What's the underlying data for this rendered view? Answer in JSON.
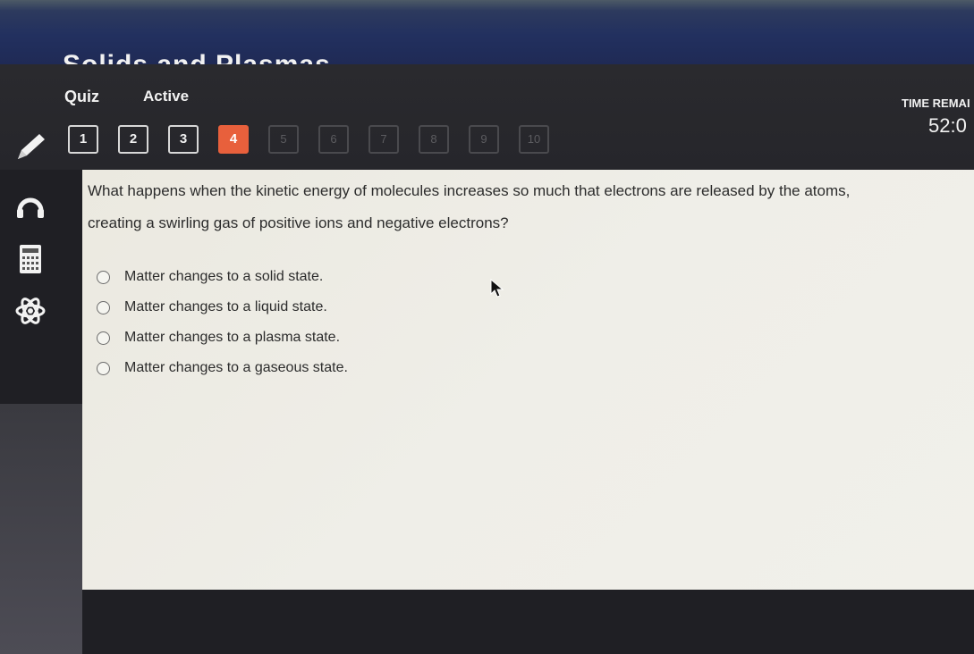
{
  "header": {
    "course_title": "Solids and Plasmas",
    "quiz_label": "Quiz",
    "status": "Active",
    "time_label": "TIME REMAI",
    "time_value": "52:0"
  },
  "question_nav": [
    {
      "label": "1",
      "state": "answered"
    },
    {
      "label": "2",
      "state": "answered"
    },
    {
      "label": "3",
      "state": "answered"
    },
    {
      "label": "4",
      "state": "current"
    },
    {
      "label": "5",
      "state": "future"
    },
    {
      "label": "6",
      "state": "future"
    },
    {
      "label": "7",
      "state": "future"
    },
    {
      "label": "8",
      "state": "future"
    },
    {
      "label": "9",
      "state": "future"
    },
    {
      "label": "10",
      "state": "future"
    }
  ],
  "sidebar": {
    "tools": [
      "pencil-icon",
      "headphones-icon",
      "calculator-icon",
      "atom-icon"
    ]
  },
  "question": {
    "text_line1": "What happens when the kinetic energy of molecules increases so much that electrons are released by the atoms,",
    "text_line2": "creating a swirling gas of positive ions and negative electrons?",
    "options": [
      "Matter changes to a solid state.",
      "Matter changes to a liquid state.",
      "Matter changes to a plasma state.",
      "Matter changes to a gaseous state."
    ]
  },
  "colors": {
    "accent": "#e8603c",
    "header_bg": "#26262b",
    "content_bg": "#efeee8"
  }
}
